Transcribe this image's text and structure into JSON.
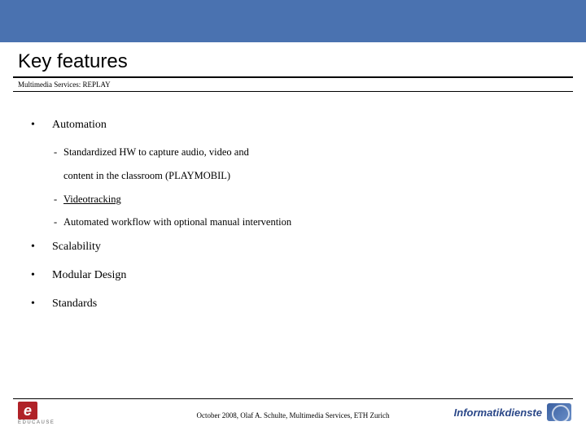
{
  "header": {
    "title": "Key features",
    "subtitle": "Multimedia Services: REPLAY"
  },
  "bullets": [
    {
      "label": "Automation",
      "subs": [
        {
          "text": "Standardized HW to capture audio, video and",
          "cont": "content in the classroom (PLAYMOBIL)"
        },
        {
          "text": "Videotracking",
          "underline": true
        },
        {
          "text": "Automated workflow with optional manual intervention"
        }
      ]
    },
    {
      "label": "Scalability"
    },
    {
      "label": "Modular Design"
    },
    {
      "label": "Standards"
    }
  ],
  "footer": {
    "text": "October 2008, Olaf A. Schulte, Multimedia Services, ETH Zurich",
    "leftLogo": {
      "glyph": "e",
      "caption": "EDUCAUSE"
    },
    "rightLogo": {
      "word": "Informatikdienste"
    }
  }
}
